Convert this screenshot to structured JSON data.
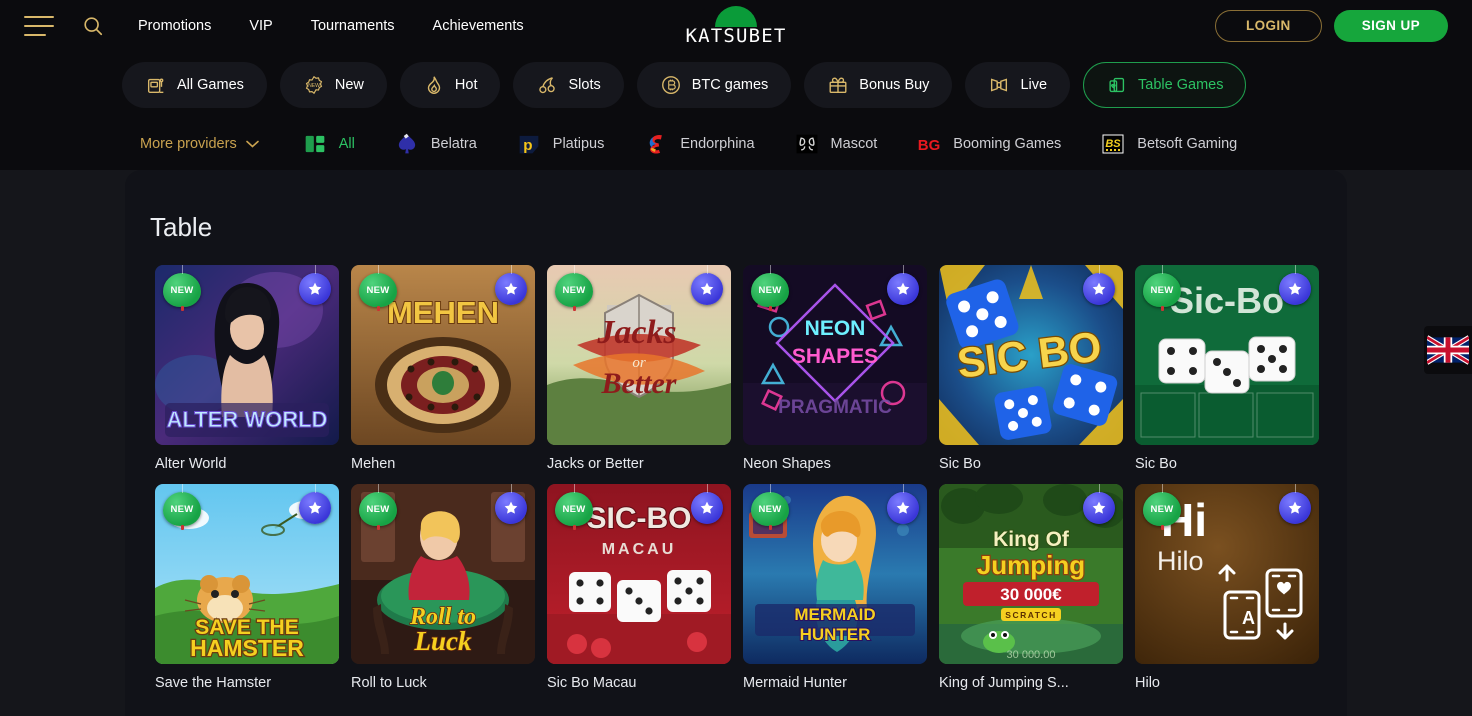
{
  "header": {
    "menu_icon": "hamburger-icon",
    "search_icon": "search-icon",
    "nav": [
      {
        "label": "Promotions"
      },
      {
        "label": "VIP"
      },
      {
        "label": "Tournaments"
      },
      {
        "label": "Achievements"
      }
    ],
    "logo_text": "KATSUBET",
    "login_label": "LOGIN",
    "signup_label": "SIGN UP"
  },
  "categories": [
    {
      "label": "All Games",
      "icon": "slot-machine-icon",
      "active": false
    },
    {
      "label": "New",
      "icon": "new-badge-icon",
      "active": false
    },
    {
      "label": "Hot",
      "icon": "flame-icon",
      "active": false
    },
    {
      "label": "Slots",
      "icon": "cherries-icon",
      "active": false
    },
    {
      "label": "BTC games",
      "icon": "bitcoin-icon",
      "active": false
    },
    {
      "label": "Bonus Buy",
      "icon": "gift-icon",
      "active": false
    },
    {
      "label": "Live",
      "icon": "bowtie-icon",
      "active": false
    },
    {
      "label": "Table Games",
      "icon": "cards-icon",
      "active": true
    }
  ],
  "providers": {
    "more_label": "More providers",
    "chevron_icon": "chevron-down-icon",
    "items": [
      {
        "label": "All",
        "logo": "grid-icon",
        "active": true
      },
      {
        "label": "Belatra",
        "logo": "belatra-spade-logo",
        "active": false
      },
      {
        "label": "Platipus",
        "logo": "platipus-p-logo",
        "active": false
      },
      {
        "label": "Endorphina",
        "logo": "endorphina-e-logo",
        "active": false
      },
      {
        "label": "Mascot",
        "logo": "mascot-logo",
        "active": false
      },
      {
        "label": "Booming Games",
        "logo": "booming-bg-logo",
        "active": false
      },
      {
        "label": "Betsoft Gaming",
        "logo": "betsoft-bs-logo",
        "active": false
      }
    ]
  },
  "content": {
    "section_title": "Table",
    "new_badge_label": "NEW",
    "favorite_icon": "star-icon",
    "games": [
      {
        "title": "Alter World",
        "art": "alter-world",
        "new": true,
        "star": true
      },
      {
        "title": "Mehen",
        "art": "mehen",
        "new": true,
        "star": true
      },
      {
        "title": "Jacks or Better",
        "art": "jacks",
        "new": true,
        "star": true
      },
      {
        "title": "Neon Shapes",
        "art": "neon",
        "new": true,
        "star": true
      },
      {
        "title": "Sic Bo",
        "art": "sicbo",
        "new": false,
        "star": true
      },
      {
        "title": "Sic Bo",
        "art": "sicbo2",
        "new": true,
        "star": true
      },
      {
        "title": "Save the Hamster",
        "art": "hamster",
        "new": true,
        "star": true
      },
      {
        "title": "Roll to Luck",
        "art": "rolltoluck",
        "new": true,
        "star": true
      },
      {
        "title": "Sic Bo Macau",
        "art": "macau",
        "new": true,
        "star": true
      },
      {
        "title": "Mermaid Hunter",
        "art": "mermaid",
        "new": true,
        "star": true
      },
      {
        "title": "King of Jumping S...",
        "art": "king",
        "new": false,
        "star": true
      },
      {
        "title": "Hilo",
        "art": "hilo",
        "new": true,
        "star": true
      }
    ]
  },
  "language": {
    "icon": "uk-flag-icon",
    "label": "EN"
  },
  "colors": {
    "gold": "#d9b86a",
    "green": "#16a63c",
    "accent_green": "#2cc263",
    "header_bg": "#0b0b0e",
    "page_bg": "#15161b",
    "panel_bg": "#111218"
  }
}
